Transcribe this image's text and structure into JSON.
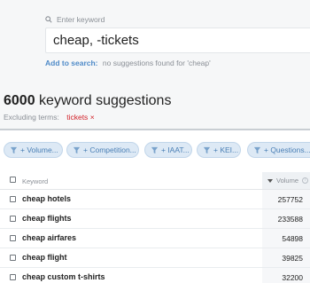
{
  "search": {
    "label": "Enter keyword",
    "value": "cheap, -tickets",
    "add_to_search_label": "Add to search:",
    "no_suggestions_msg": "no suggestions found for 'cheap'"
  },
  "summary": {
    "count": "6000",
    "suffix": " keyword suggestions",
    "excluding_label": "Excluding terms:",
    "excluded_term": "tickets",
    "remove_glyph": "×"
  },
  "filters": [
    {
      "label": "+ Volume..."
    },
    {
      "label": "+ Competition..."
    },
    {
      "label": "+ IAAT..."
    },
    {
      "label": "+ KEI..."
    },
    {
      "label": "+ Questions..."
    }
  ],
  "table": {
    "columns": {
      "keyword": "Keyword",
      "volume": "Volume",
      "info": "i"
    },
    "rows": [
      {
        "keyword": "cheap hotels",
        "volume": "257752"
      },
      {
        "keyword": "cheap flights",
        "volume": "233588"
      },
      {
        "keyword": "cheap airfares",
        "volume": "54898"
      },
      {
        "keyword": "cheap flight",
        "volume": "39825"
      },
      {
        "keyword": "cheap custom t-shirts",
        "volume": "32200"
      }
    ]
  },
  "colors": {
    "accent_blue": "#4e8ac8",
    "excluded_red": "#d2232a",
    "chip_bg": "#dde9f5"
  },
  "icons": {
    "search": "search-icon",
    "filter": "funnel-icon",
    "sort": "sort-desc-icon",
    "info": "info-icon"
  }
}
